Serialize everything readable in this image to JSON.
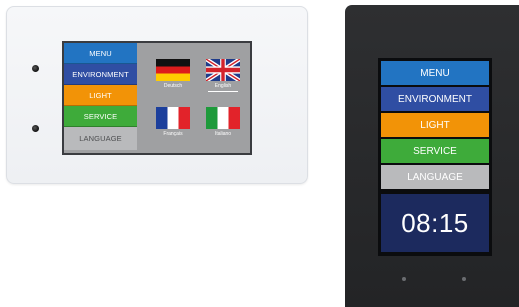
{
  "horizontal_device": {
    "menu": [
      "MENU",
      "ENVIRONMENT",
      "LIGHT",
      "SERVICE",
      "LANGUAGE"
    ],
    "languages": [
      {
        "label": "Deutsch",
        "flag": "germany-flag-icon"
      },
      {
        "label": "English",
        "flag": "uk-flag-icon"
      },
      {
        "label": "Français",
        "flag": "france-flag-icon"
      },
      {
        "label": "Italiano",
        "flag": "italy-flag-icon"
      }
    ]
  },
  "vertical_device": {
    "menu": [
      "MENU",
      "ENVIRONMENT",
      "LIGHT",
      "SERVICE",
      "LANGUAGE"
    ],
    "clock": "08:15"
  },
  "colors": {
    "menu": "#2274c2",
    "environment": "#2f4ea3",
    "light": "#f29307",
    "service": "#3eab3a",
    "language": "#b9babc",
    "clock_bg": "#1c2a5e"
  }
}
